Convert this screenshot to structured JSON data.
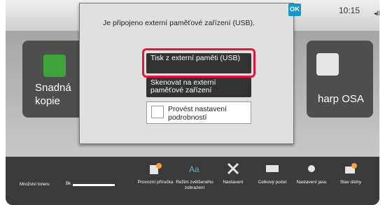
{
  "status": {
    "time": "10:15",
    "right_glyph": "◂ll"
  },
  "home": {
    "tiles": [
      {
        "label": "Snadná kopie"
      },
      {
        "label": "harp OSA"
      }
    ],
    "next_glyph": "▶"
  },
  "dialog": {
    "message": "Je připojeno externí paměťové zařízení (USB).",
    "ok_label": "OK",
    "print_button": "Tisk z externí paměti (USB)",
    "scan_button": "Skenovat na externí paměťové zařízení",
    "settings_label": "Provést nastavení podrobností"
  },
  "bottom_bar": {
    "toner_label": "Množství toneru",
    "toner_channel": "Bk",
    "items": [
      {
        "label": "Provozní příručka",
        "icon": "manual-icon"
      },
      {
        "label": "Režim zvětšeného zobrazení",
        "icon": "enlarge-display-icon"
      },
      {
        "label": "Nastavení",
        "icon": "tools-icon"
      },
      {
        "label": "Celkový počet",
        "icon": "counter-icon"
      },
      {
        "label": "Nastavení jasu",
        "icon": "brightness-icon"
      },
      {
        "label": "Stav úlohy",
        "icon": "job-status-icon"
      }
    ]
  }
}
